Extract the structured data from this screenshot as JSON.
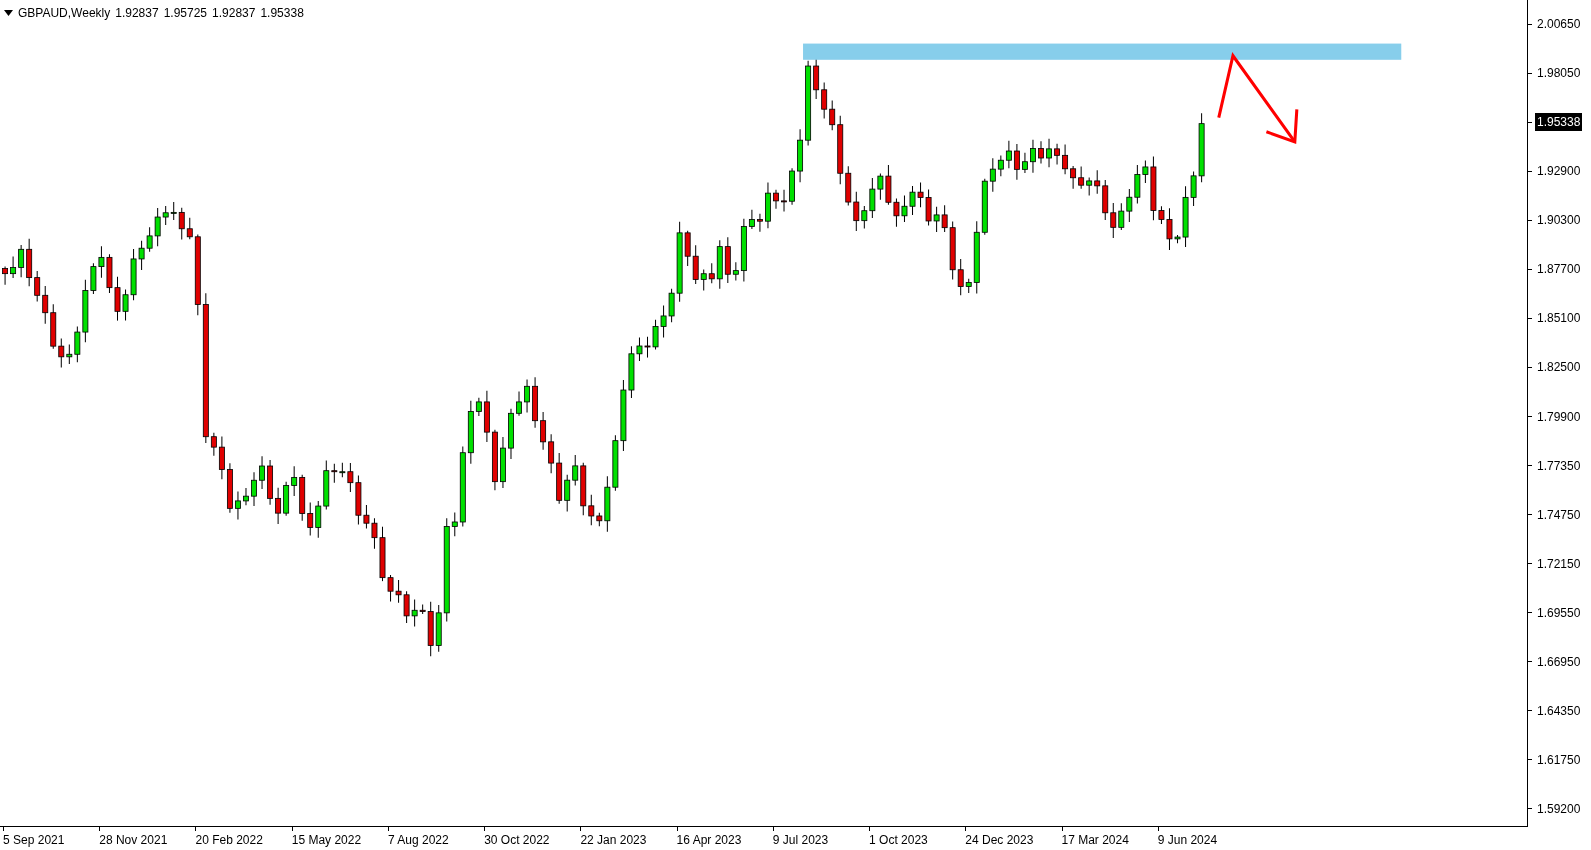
{
  "header": {
    "title": "GBPAUD,Weekly",
    "values": [
      "1.92837",
      "1.95725",
      "1.92837",
      "1.95338"
    ]
  },
  "price_axis": {
    "labels": [
      {
        "text": "2.00650",
        "highlighted": false
      },
      {
        "text": "1.98050",
        "highlighted": false
      },
      {
        "text": "1.95338",
        "highlighted": true
      },
      {
        "text": "1.92900",
        "highlighted": false
      },
      {
        "text": "1.90300",
        "highlighted": false
      },
      {
        "text": "1.87700",
        "highlighted": false
      },
      {
        "text": "1.85100",
        "highlighted": false
      },
      {
        "text": "1.82500",
        "highlighted": false
      },
      {
        "text": "1.79900",
        "highlighted": false
      },
      {
        "text": "1.77350",
        "highlighted": false
      },
      {
        "text": "1.74750",
        "highlighted": false
      },
      {
        "text": "1.72150",
        "highlighted": false
      },
      {
        "text": "1.69550",
        "highlighted": false
      },
      {
        "text": "1.66950",
        "highlighted": false
      },
      {
        "text": "1.64350",
        "highlighted": false
      },
      {
        "text": "1.61750",
        "highlighted": false
      },
      {
        "text": "1.59200",
        "highlighted": false
      }
    ]
  },
  "time_axis": {
    "labels": [
      "5 Sep 2021",
      "28 Nov 2021",
      "20 Feb 2022",
      "15 May 2022",
      "7 Aug 2022",
      "30 Oct 2022",
      "22 Jan 2023",
      "16 Apr 2023",
      "9 Jul 2023",
      "1 Oct 2023",
      "24 Dec 2023",
      "17 Mar 2024",
      "9 Jun 2024"
    ]
  }
}
